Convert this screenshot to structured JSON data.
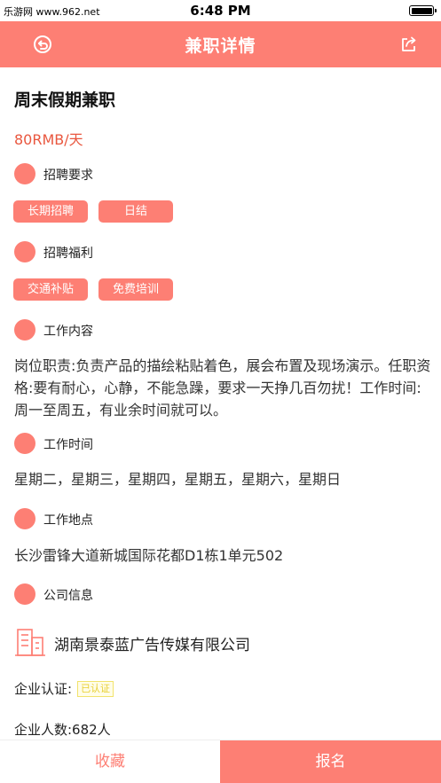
{
  "status_bar": {
    "carrier": "乐游网 www.962.net",
    "time": "6:48 PM",
    "battery_level": 1.0
  },
  "nav": {
    "title": "兼职详情",
    "back_icon": "back-arrow-circle-icon",
    "share_icon": "share-icon"
  },
  "job": {
    "title": "周末假期兼职",
    "salary": "80RMB/天"
  },
  "sections": {
    "requirements": {
      "label": "招聘要求",
      "tags": [
        "长期招聘",
        "日结"
      ]
    },
    "benefits": {
      "label": "招聘福利",
      "tags": [
        "交通补贴",
        "免费培训"
      ]
    },
    "content": {
      "label": "工作内容",
      "text": "岗位职责:负责产品的描绘粘贴着色，展会布置及现场演示。任职资格:要有耐心，心静，不能急躁，要求一天挣几百勿扰！工作时间:周一至周五，有业余时间就可以。"
    },
    "time": {
      "label": "工作时间",
      "text": "星期二，星期三，星期四，星期五，星期六，星期日"
    },
    "location": {
      "label": "工作地点",
      "text": "长沙雷锋大道新城国际花都D1栋1单元502"
    },
    "company": {
      "label": "公司信息",
      "icon": "building-icon",
      "name": "湖南景泰蓝广告传媒有限公司",
      "cert_label": "企业认证:",
      "cert_badge": "已认证",
      "staff": "企业人数:682人"
    }
  },
  "bottom": {
    "favorite": "收藏",
    "apply": "报名"
  },
  "colors": {
    "accent": "#fd7f74",
    "salary": "#e9573f",
    "badge": "#e8cf33"
  }
}
